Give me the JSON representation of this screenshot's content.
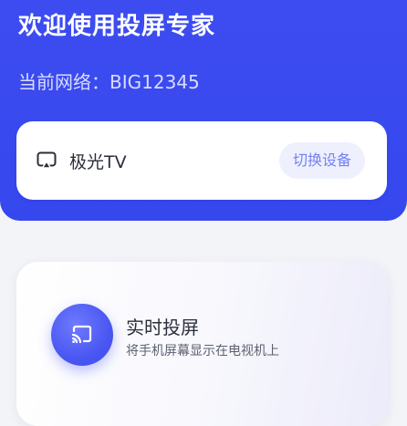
{
  "header": {
    "title": "欢迎使用投屏专家",
    "network_label": "当前网络：",
    "network_name": "BIG12345"
  },
  "device_card": {
    "icon": "cast-screen-icon",
    "device_name": "极光TV",
    "switch_label": "切换设备"
  },
  "feature_card": {
    "icon": "screen-mirror-icon",
    "title": "实时投屏",
    "description": "将手机屏幕显示在电视机上"
  },
  "colors": {
    "brand_blue": "#3d4cf0",
    "switch_text": "#7481f0",
    "switch_bg": "#eef0fe",
    "page_bg": "#f3f4f8"
  }
}
